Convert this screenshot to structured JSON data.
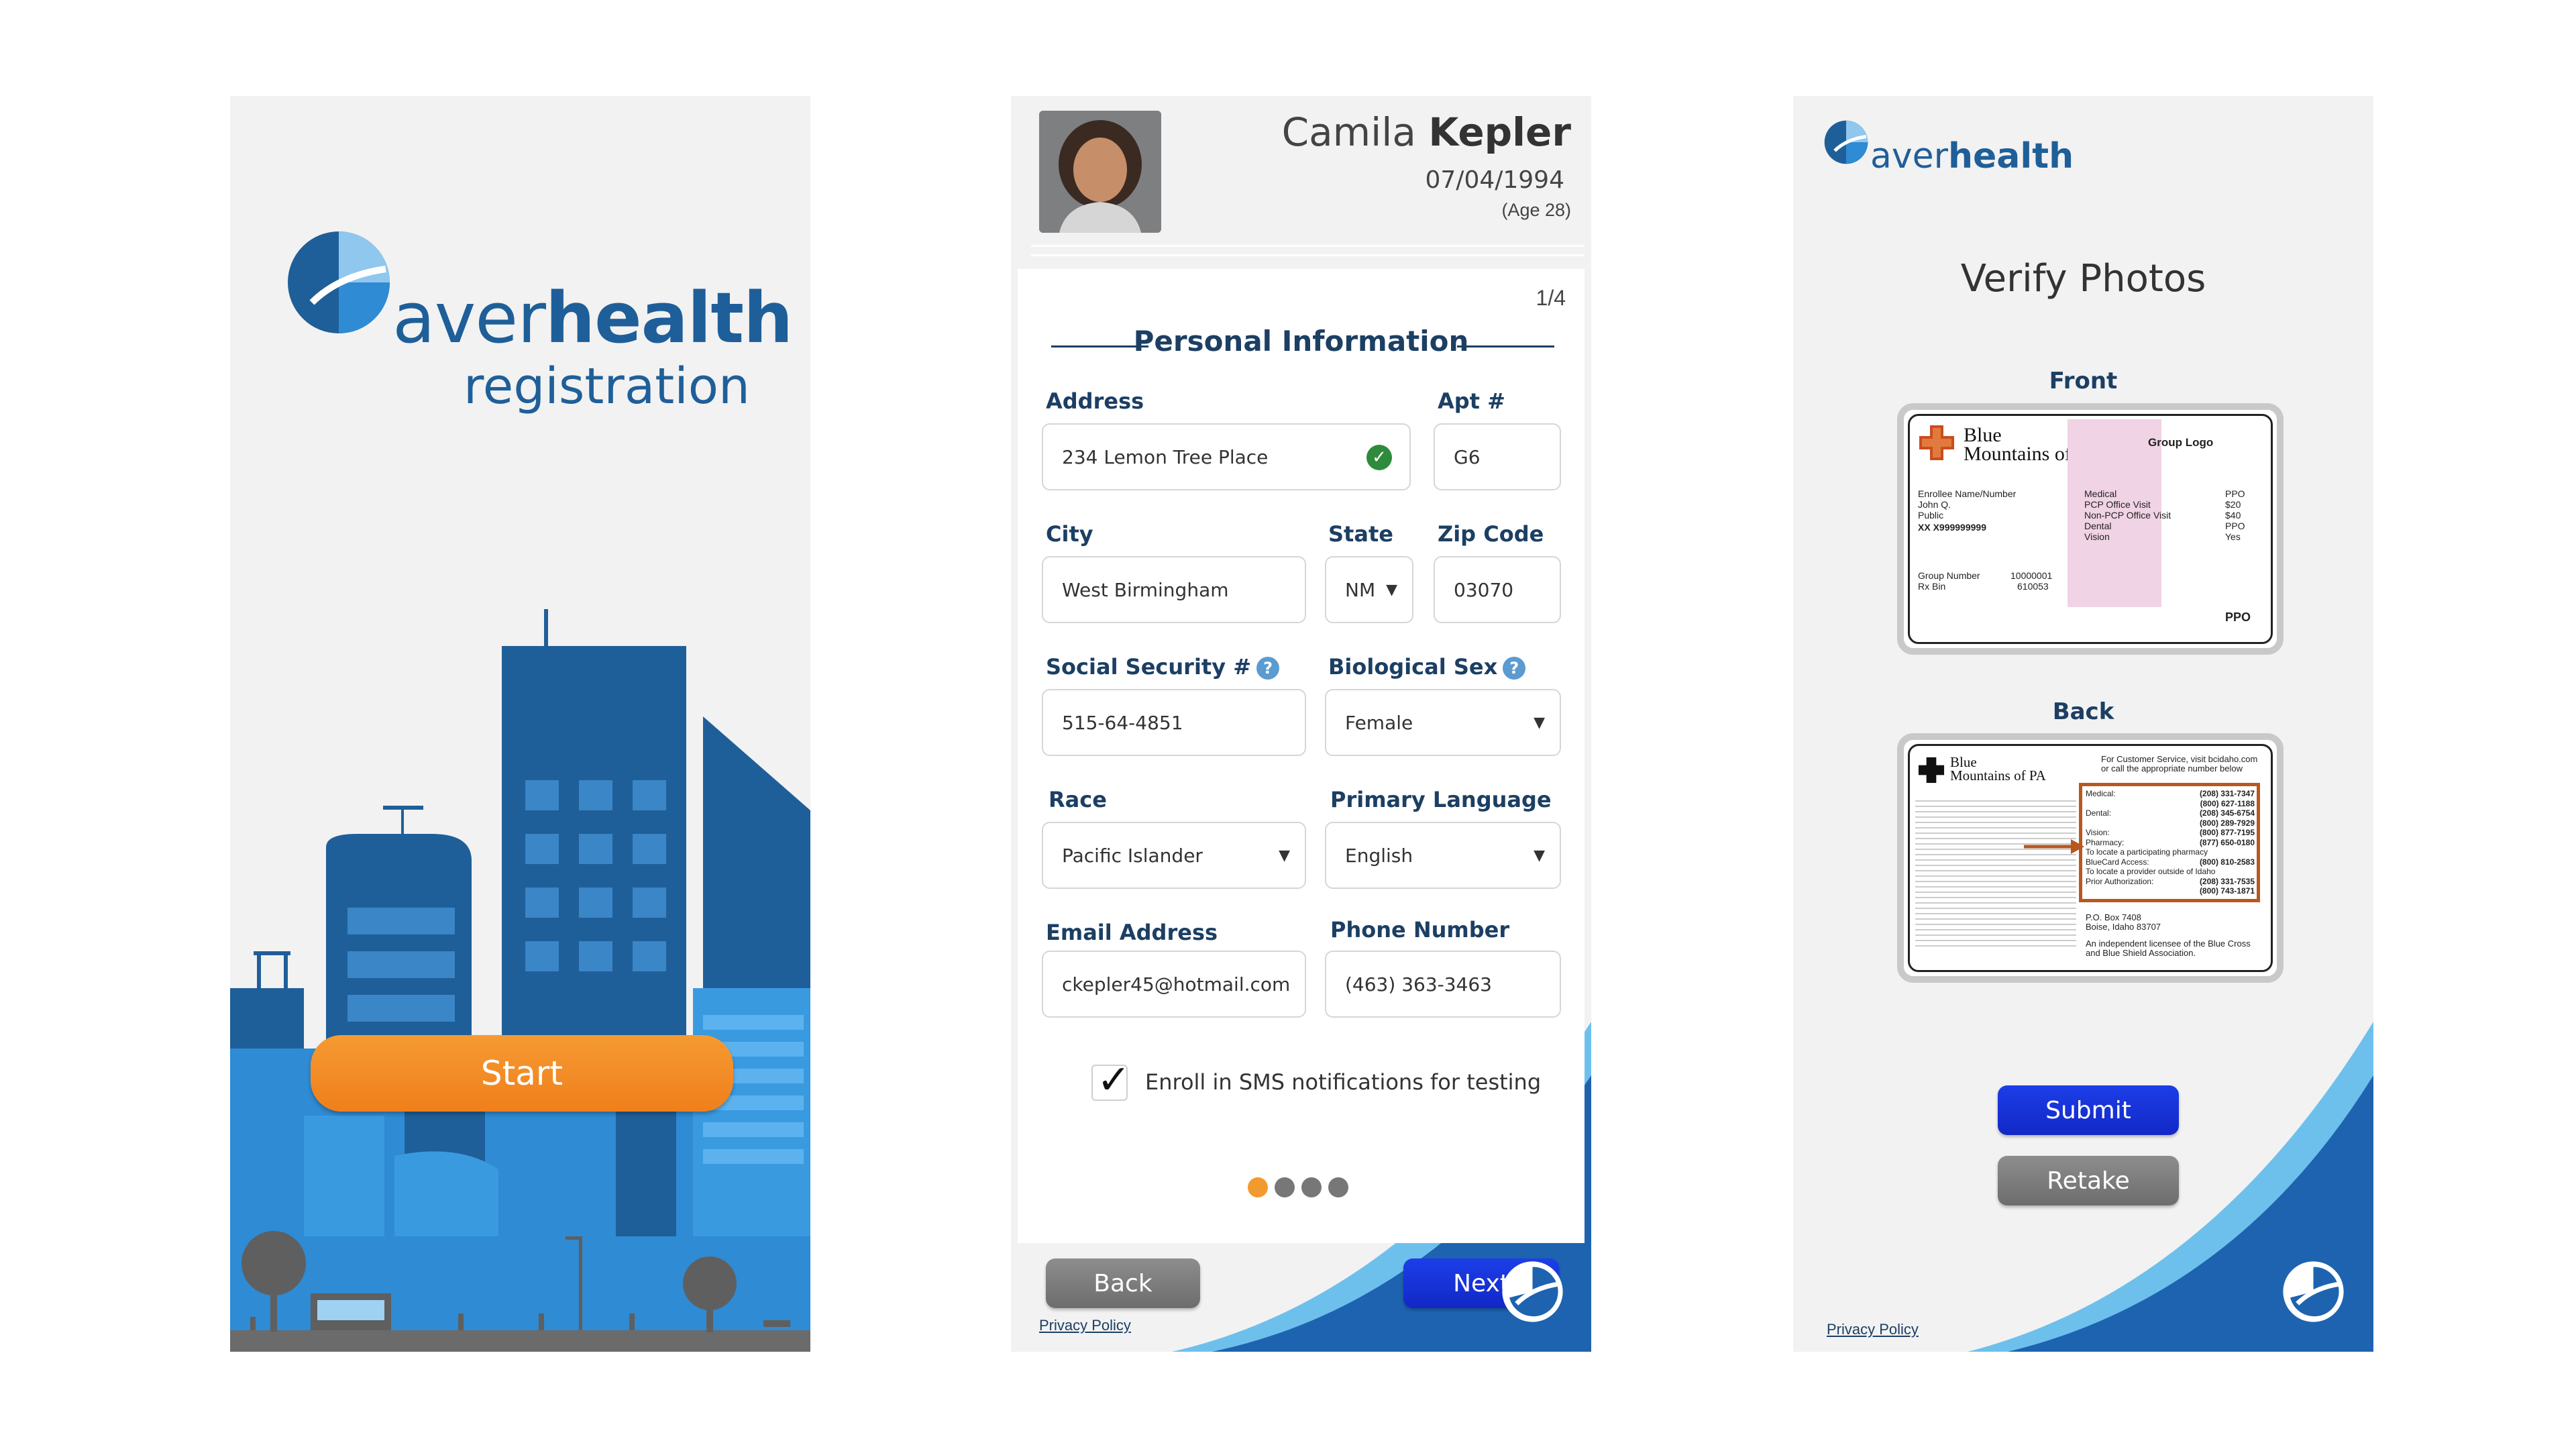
{
  "screen1": {
    "brand_prefix": "aver",
    "brand_suffix": "health",
    "subtitle": "registration",
    "start_label": "Start"
  },
  "screen2": {
    "first_name": "Camila",
    "last_name": "Kepler",
    "dob": "07/04/1994",
    "age": "(Age 28)",
    "counter": "1/4",
    "section_title": "Personal Information",
    "fields": {
      "address": {
        "label": "Address",
        "value": "234 Lemon Tree Place"
      },
      "apt": {
        "label": "Apt #",
        "value": "G6"
      },
      "city": {
        "label": "City",
        "value": "West Birmingham"
      },
      "state": {
        "label": "State",
        "value": "NM"
      },
      "zip": {
        "label": "Zip Code",
        "value": "03070"
      },
      "ssn": {
        "label": "Social Security #",
        "value": "515-64-4851"
      },
      "sex": {
        "label": "Biological Sex",
        "value": "Female"
      },
      "race": {
        "label": "Race",
        "value": "Pacific Islander"
      },
      "language": {
        "label": "Primary Language",
        "value": "English"
      },
      "email": {
        "label": "Email Address",
        "value": "ckepler45@hotmail.com"
      },
      "phone": {
        "label": "Phone Number",
        "value": "(463) 363-3463"
      }
    },
    "help_glyph": "?",
    "sms_label": "Enroll in SMS notifications for testing",
    "sms_checked": true,
    "back_label": "Back",
    "next_label": "Next",
    "steps_total": 4,
    "step_current": 1,
    "privacy": "Privacy Policy"
  },
  "screen3": {
    "brand_prefix": "aver",
    "brand_suffix": "health",
    "title": "Verify Photos",
    "front_label": "Front",
    "back_label": "Back",
    "submit_label": "Submit",
    "retake_label": "Retake",
    "privacy": "Privacy Policy",
    "card_front": {
      "insurer_line1": "Blue",
      "insurer_line2": "Mountains of PA",
      "group_logo": "Group Logo",
      "enrollee_label": "Enrollee Name/Number",
      "enrollee_first": "John Q.",
      "enrollee_last": "Public",
      "enrollee_id": "XX X999999999",
      "group_number_label": "Group Number",
      "group_number": "10000001",
      "rx_bin_label": "Rx Bin",
      "rx_bin": "610053",
      "plan_type": "PPO",
      "benefits": [
        {
          "name": "Medical",
          "value": "PPO"
        },
        {
          "name": "PCP Office Visit",
          "value": "$20"
        },
        {
          "name": "Non-PCP Office Visit",
          "value": "$40"
        },
        {
          "name": "Dental",
          "value": "PPO"
        },
        {
          "name": "Vision",
          "value": "Yes"
        }
      ],
      "badge": "PPO"
    },
    "card_back": {
      "insurer_line1": "Blue",
      "insurer_line2": "Mountains of PA",
      "service_line": "For Customer Service, visit bcidaho.com",
      "service_line2": "or call the appropriate number below",
      "phones": [
        {
          "name": "Medical:",
          "value": "(208) 331-7347"
        },
        {
          "name": "",
          "value": "(800) 627-1188"
        },
        {
          "name": "Dental:",
          "value": "(208) 345-6754"
        },
        {
          "name": "",
          "value": "(800) 289-7929"
        },
        {
          "name": "Vision:",
          "value": "(800) 877-7195"
        },
        {
          "name": "Pharmacy:",
          "value": "(877) 650-0180"
        },
        {
          "name": "To locate a participating pharmacy",
          "value": ""
        },
        {
          "name": "BlueCard Access:",
          "value": "(800) 810-2583"
        },
        {
          "name": "To locate a provider outside of Idaho",
          "value": ""
        },
        {
          "name": "Prior Authorization:",
          "value": "(208) 331-7535"
        },
        {
          "name": "",
          "value": "(800) 743-1871"
        }
      ],
      "address1": "P.O. Box 7408",
      "address2": "Boise, Idaho 83707",
      "licensee": "An independent licensee of the Blue Cross and Blue Shield Association."
    }
  }
}
